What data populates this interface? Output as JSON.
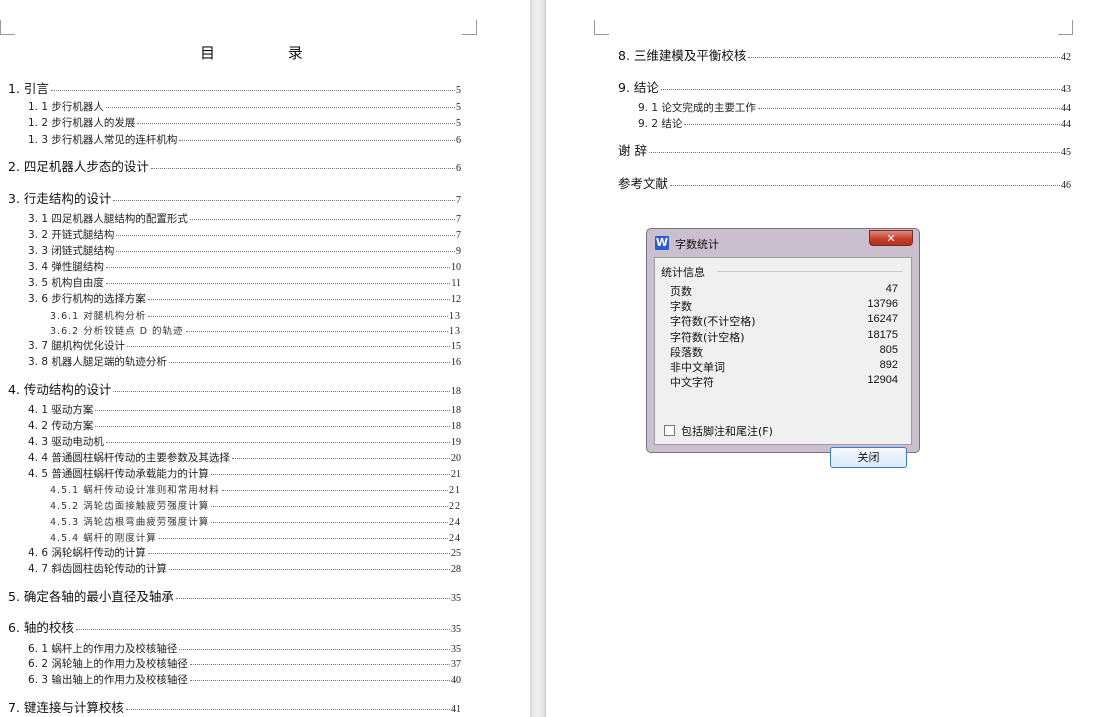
{
  "toc": {
    "title": "目 录",
    "left_entries": [
      {
        "level": 1,
        "text": "1.  引言",
        "page": "5"
      },
      {
        "level": 2,
        "text": "1. 1  步行机器人",
        "page": "5"
      },
      {
        "level": 2,
        "text": "1. 2  步行机器人的发展",
        "page": "5"
      },
      {
        "level": 2,
        "text": "1. 3  步行机器人常见的连杆机构",
        "page": "6"
      },
      {
        "level": 1,
        "text": "2.  四足机器人步态的设计",
        "page": "6"
      },
      {
        "level": 1,
        "text": "3.    行走结构的设计",
        "page": "7"
      },
      {
        "level": 2,
        "text": "3. 1  四足机器人腿结构的配置形式",
        "page": "7"
      },
      {
        "level": 2,
        "text": "3. 2  开链式腿结构",
        "page": "7"
      },
      {
        "level": 2,
        "text": "3. 3  闭链式腿结构",
        "page": "9"
      },
      {
        "level": 2,
        "text": "3. 4  弹性腿结构",
        "page": "10"
      },
      {
        "level": 2,
        "text": "3. 5  机构自由度",
        "page": "11"
      },
      {
        "level": 2,
        "text": "3. 6  步行机构的选择方案",
        "page": "12"
      },
      {
        "level": 3,
        "text": "3.6.1  对腿机构分析",
        "page": "13"
      },
      {
        "level": 3,
        "text": "3.6.2  分析铰链点 D 的轨迹",
        "page": "13"
      },
      {
        "level": 2,
        "text": "3. 7  腿机构优化设计",
        "page": "15"
      },
      {
        "level": 2,
        "text": "3. 8  机器人腿足端的轨迹分析",
        "page": "16"
      },
      {
        "level": 1,
        "text": "4.    传动结构的设计",
        "page": "18"
      },
      {
        "level": 2,
        "text": "4. 1  驱动方案",
        "page": "18"
      },
      {
        "level": 2,
        "text": "4. 2  传动方案",
        "page": "18"
      },
      {
        "level": 2,
        "text": "4. 3  驱动电动机",
        "page": "19"
      },
      {
        "level": 2,
        "text": "4. 4  普通圆柱蜗杆传动的主要参数及其选择",
        "page": "20"
      },
      {
        "level": 2,
        "text": "4. 5  普通圆柱蜗杆传动承载能力的计算",
        "page": "21"
      },
      {
        "level": 3,
        "text": "4.5.1  蜗杆传动设计准则和常用材料",
        "page": "21"
      },
      {
        "level": 3,
        "text": "4.5.2  涡轮齿面接触疲劳强度计算",
        "page": "22"
      },
      {
        "level": 3,
        "text": "4.5.3  涡轮齿根弯曲疲劳强度计算",
        "page": "24"
      },
      {
        "level": 3,
        "text": "4.5.4  蜗杆的刚度计算",
        "page": "24"
      },
      {
        "level": 2,
        "text": "4. 6  涡轮蜗杆传动的计算",
        "page": "25"
      },
      {
        "level": 2,
        "text": "4. 7 斜齿圆柱齿轮传动的计算",
        "page": "28"
      },
      {
        "level": 1,
        "text": "5.    确定各轴的最小直径及轴承",
        "page": "35"
      },
      {
        "level": 1,
        "text": "6.    轴的校核",
        "page": "35"
      },
      {
        "level": 2,
        "text": "6. 1  蜗杆上的作用力及校核轴径",
        "page": "35"
      },
      {
        "level": 2,
        "text": "6. 2  涡轮轴上的作用力及校核轴径",
        "page": "37"
      },
      {
        "level": 2,
        "text": "6. 3  输出轴上的作用力及校核轴径",
        "page": "40"
      },
      {
        "level": 1,
        "text": "7.    键连接与计算校核",
        "page": "41"
      }
    ],
    "right_entries": [
      {
        "level": 1,
        "text": "8.    三维建模及平衡校核",
        "page": "42"
      },
      {
        "level": 1,
        "text": "9.    结论",
        "page": "43"
      },
      {
        "level": 2,
        "text": "9. 1  论文完成的主要工作",
        "page": "44"
      },
      {
        "level": 2,
        "text": "9. 2  结论",
        "page": "44"
      },
      {
        "level": 1,
        "text": "谢    辞",
        "page": "45"
      },
      {
        "level": 1,
        "text": "参考文献",
        "page": "46"
      }
    ]
  },
  "dialog": {
    "title": "字数统计",
    "app_icon": "W",
    "close_glyph": "✕",
    "group_label": "统计信息",
    "stats": [
      {
        "label": "页数",
        "value": "47"
      },
      {
        "label": "字数",
        "value": "13796"
      },
      {
        "label": "字符数(不计空格)",
        "value": "16247"
      },
      {
        "label": "字符数(计空格)",
        "value": "18175"
      },
      {
        "label": "段落数",
        "value": "805"
      },
      {
        "label": "非中文单词",
        "value": "892"
      },
      {
        "label": "中文字符",
        "value": "12904"
      }
    ],
    "checkbox_label": "包括脚注和尾注(F)",
    "checkbox_checked": false,
    "ok_label": "关闭"
  },
  "colors": {
    "dialog_frame": "#c9bfcf",
    "close_button": "#c4402c",
    "app_icon": "#2a5bd7"
  }
}
